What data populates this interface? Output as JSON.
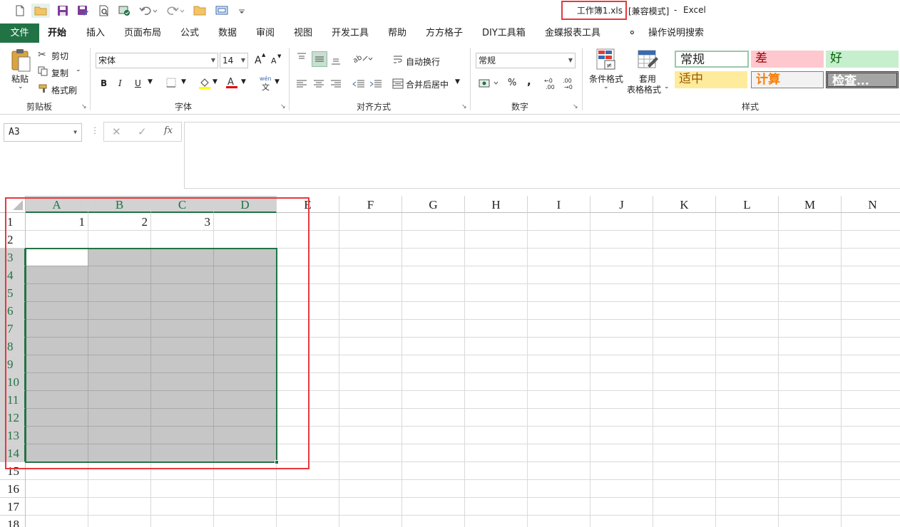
{
  "window": {
    "filename": "工作簿1.xls",
    "mode": "[兼容模式]",
    "separator": "-",
    "app": "Excel"
  },
  "quick_access": {
    "icons": [
      "new-file-icon",
      "open-folder-icon",
      "save-icon",
      "save-as-icon",
      "print-preview-icon",
      "compat-check-icon",
      "undo-icon",
      "redo-icon",
      "folder-icon",
      "screen-capture-icon",
      "customize-qat-icon"
    ]
  },
  "tabs": {
    "file": "文件",
    "home": "开始",
    "insert": "插入",
    "page_layout": "页面布局",
    "formulas": "公式",
    "data": "数据",
    "review": "审阅",
    "view": "视图",
    "developer": "开发工具",
    "help": "帮助",
    "ffgz": "方方格子",
    "diy": "DIY工具箱",
    "kingdee": "金蝶报表工具",
    "tell_me": "操作说明搜索"
  },
  "clipboard": {
    "paste": "粘贴",
    "cut": "剪切",
    "copy": "复制",
    "format_painter": "格式刷",
    "group": "剪贴板"
  },
  "font": {
    "name": "宋体",
    "size": "14",
    "group": "字体",
    "bold": "B",
    "italic": "I",
    "underline": "U",
    "grow": "A",
    "shrink": "A",
    "phonetic": "wén"
  },
  "alignment": {
    "wrap": "自动换行",
    "merge": "合并后居中",
    "group": "对齐方式"
  },
  "number": {
    "format": "常规",
    "percent": "%",
    "comma": ",",
    "group": "数字"
  },
  "styles": {
    "conditional": "条件格式",
    "table_format_1": "套用",
    "table_format_2": "表格格式",
    "group": "样式",
    "normal": "常规",
    "bad": "差",
    "good": "好",
    "neutral": "适中",
    "calculation": "计算",
    "check": "检查...",
    "colors": {
      "normal_border": "#9bc7a9",
      "bad_bg": "#ffc7ce",
      "bad_fg": "#9c0006",
      "good_bg": "#c6efce",
      "good_fg": "#006100",
      "neutral_bg": "#ffeb9c",
      "neutral_fg": "#9c5700",
      "calc_bg": "#f2f2f2",
      "calc_fg": "#fa7d00",
      "check_bg": "#a5a5a5",
      "check_fg": "#ffffff"
    }
  },
  "formula_bar": {
    "name_box": "A3",
    "fx": "fx",
    "content": ""
  },
  "sheet": {
    "columns": [
      "A",
      "B",
      "C",
      "D",
      "E",
      "F",
      "G",
      "H",
      "I",
      "J",
      "K",
      "L",
      "M",
      "N"
    ],
    "rows": [
      "1",
      "2",
      "3",
      "4",
      "5",
      "6",
      "7",
      "8",
      "9",
      "10",
      "11",
      "12",
      "13",
      "14",
      "15",
      "16",
      "17",
      "18"
    ],
    "cells": {
      "A1": "1",
      "B1": "2",
      "C1": "3"
    },
    "selection": "A3:D14",
    "active_cell": "A3",
    "accent": "#217346",
    "highlight": "#e8383d"
  }
}
